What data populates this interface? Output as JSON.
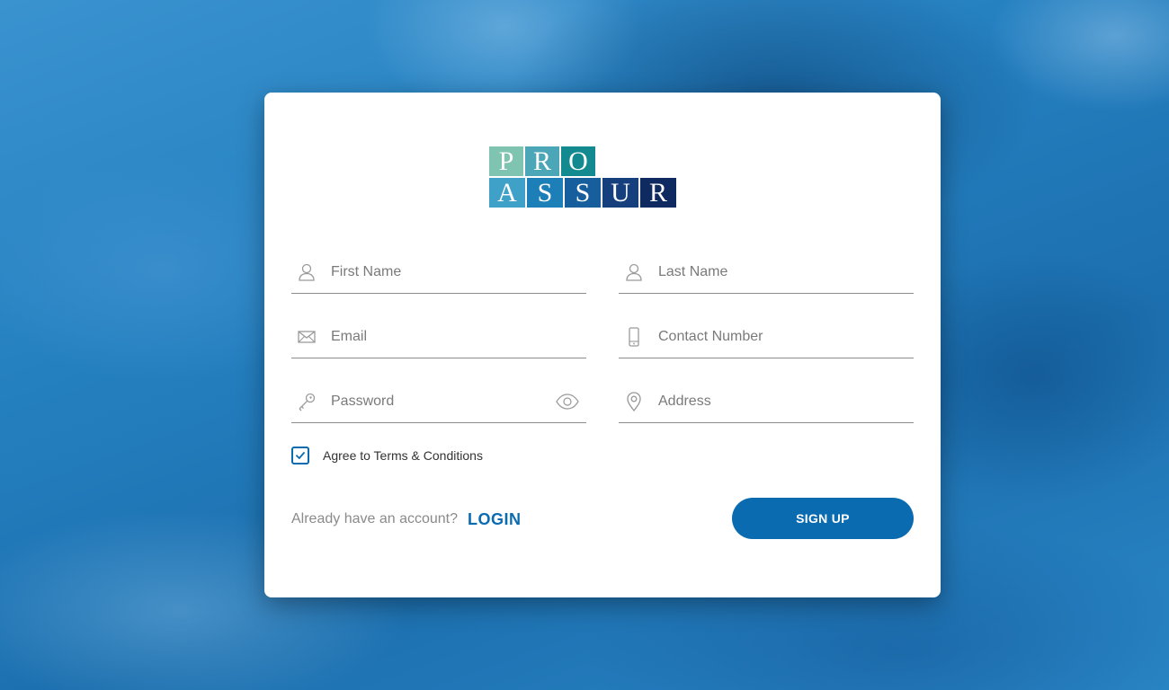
{
  "logo": {
    "row1": [
      "P",
      "R",
      "O"
    ],
    "row2": [
      "A",
      "S",
      "S",
      "U",
      "R"
    ],
    "row1_colors": [
      "#7fc4b0",
      "#4ba6b7",
      "#138a8f"
    ],
    "row2_colors": [
      "#3fa0c8",
      "#1c7fb8",
      "#175f9c",
      "#153f7d",
      "#0f2a60"
    ]
  },
  "form": {
    "first_name_placeholder": "First Name",
    "last_name_placeholder": "Last Name",
    "email_placeholder": "Email",
    "contact_placeholder": "Contact Number",
    "password_placeholder": "Password",
    "address_placeholder": "Address",
    "terms_label": "Agree to Terms & Conditions",
    "terms_checked": true
  },
  "footer": {
    "account_text": "Already have an account?",
    "login_label": "LOGIN",
    "signup_label": "SIGN UP"
  },
  "colors": {
    "accent": "#0a6bb0",
    "background": "#1f77b8",
    "icon": "#9a9a9a"
  },
  "icons": {
    "first_name": "user-icon",
    "last_name": "user-icon",
    "email": "envelope-icon",
    "contact": "mobile-phone-icon",
    "password": "key-icon",
    "password_toggle": "eye-icon",
    "address": "location-pin-icon",
    "checkbox": "checkmark-icon"
  }
}
